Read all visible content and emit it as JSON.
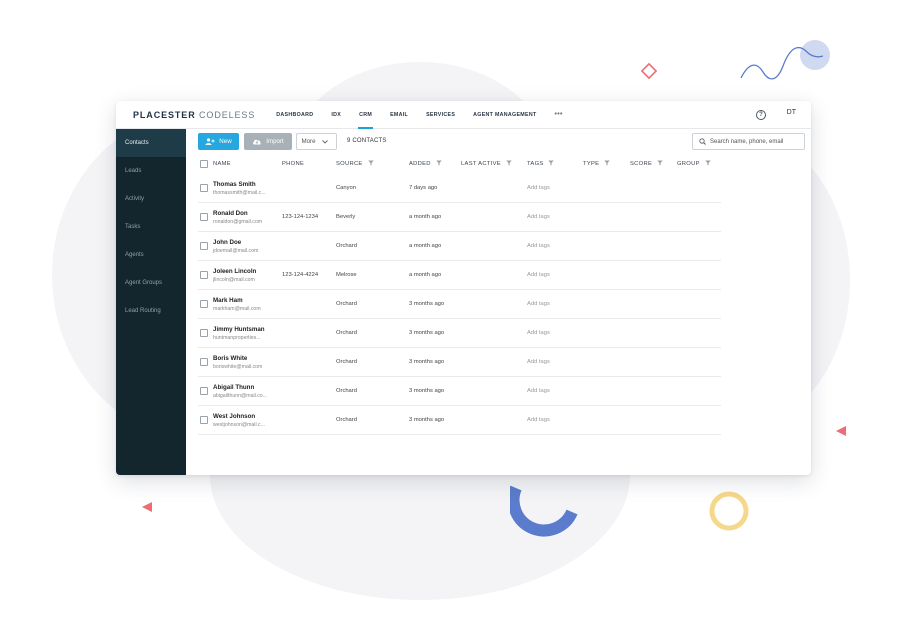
{
  "app": {
    "logo_bold": "PLACESTER",
    "logo_light": "CODELESS",
    "nav": [
      {
        "label": "DASHBOARD"
      },
      {
        "label": "IDX"
      },
      {
        "label": "CRM"
      },
      {
        "label": "EMAIL"
      },
      {
        "label": "SERVICES"
      },
      {
        "label": "AGENT MANAGEMENT"
      },
      {
        "label": "•••"
      }
    ],
    "active_nav": "CRM",
    "help_glyph": "?",
    "avatar": "DT"
  },
  "sidebar": {
    "items": [
      {
        "label": "Contacts"
      },
      {
        "label": "Leads"
      },
      {
        "label": "Activity"
      },
      {
        "label": "Tasks"
      },
      {
        "label": "Agents"
      },
      {
        "label": "Agent Groups"
      },
      {
        "label": "Lead Routing"
      }
    ],
    "active": "Contacts"
  },
  "toolbar": {
    "new_label": "New",
    "import_label": "Import",
    "more_label": "More",
    "count_label": "9 CONTACTS",
    "search_placeholder": "Search name, phone, email"
  },
  "table": {
    "columns": [
      "NAME",
      "PHONE",
      "SOURCE",
      "ADDED",
      "LAST ACTIVE",
      "TAGS",
      "TYPE",
      "SCORE",
      "GROUP"
    ],
    "rows": [
      {
        "name": "Thomas Smith",
        "email": "thomassmith@mail.c...",
        "phone": "",
        "source": "Canyon",
        "added": "7 days ago",
        "tags": "Add tags"
      },
      {
        "name": "Ronald Don",
        "email": "ronaldon@gmail.com",
        "phone": "123-124-1234",
        "source": "Beverly",
        "added": "a month ago",
        "tags": "Add tags"
      },
      {
        "name": "John Doe",
        "email": "jdoemail@mail.com",
        "phone": "",
        "source": "Orchard",
        "added": "a month ago",
        "tags": "Add tags"
      },
      {
        "name": "Joleen Lincoln",
        "email": "jlincoln@mail.com",
        "phone": "123-124-4224",
        "source": "Melrose",
        "added": "a month ago",
        "tags": "Add tags"
      },
      {
        "name": "Mark Ham",
        "email": "markham@mail.com",
        "phone": "",
        "source": "Orchard",
        "added": "3 months ago",
        "tags": "Add tags"
      },
      {
        "name": "Jimmy Huntsman",
        "email": "huntmanproperties...",
        "phone": "",
        "source": "Orchard",
        "added": "3 months ago",
        "tags": "Add tags"
      },
      {
        "name": "Boris White",
        "email": "boriswhite@mail.com",
        "phone": "",
        "source": "Orchard",
        "added": "3 months ago",
        "tags": "Add tags"
      },
      {
        "name": "Abigail Thunn",
        "email": "abigailthunn@mail.co...",
        "phone": "",
        "source": "Orchard",
        "added": "3 months ago",
        "tags": "Add tags"
      },
      {
        "name": "West Johnson",
        "email": "westjohnson@mail.c...",
        "phone": "",
        "source": "Orchard",
        "added": "3 months ago",
        "tags": "Add tags"
      }
    ]
  },
  "colors": {
    "accent": "#27a7df",
    "sidebar_bg": "#13262e",
    "sidebar_active": "#1e3c48",
    "decor_blue": "#5b7ccc",
    "decor_yellow": "#f6d88a",
    "decor_red": "#ec6d74",
    "decor_light_blue": "#cfdaf0"
  }
}
